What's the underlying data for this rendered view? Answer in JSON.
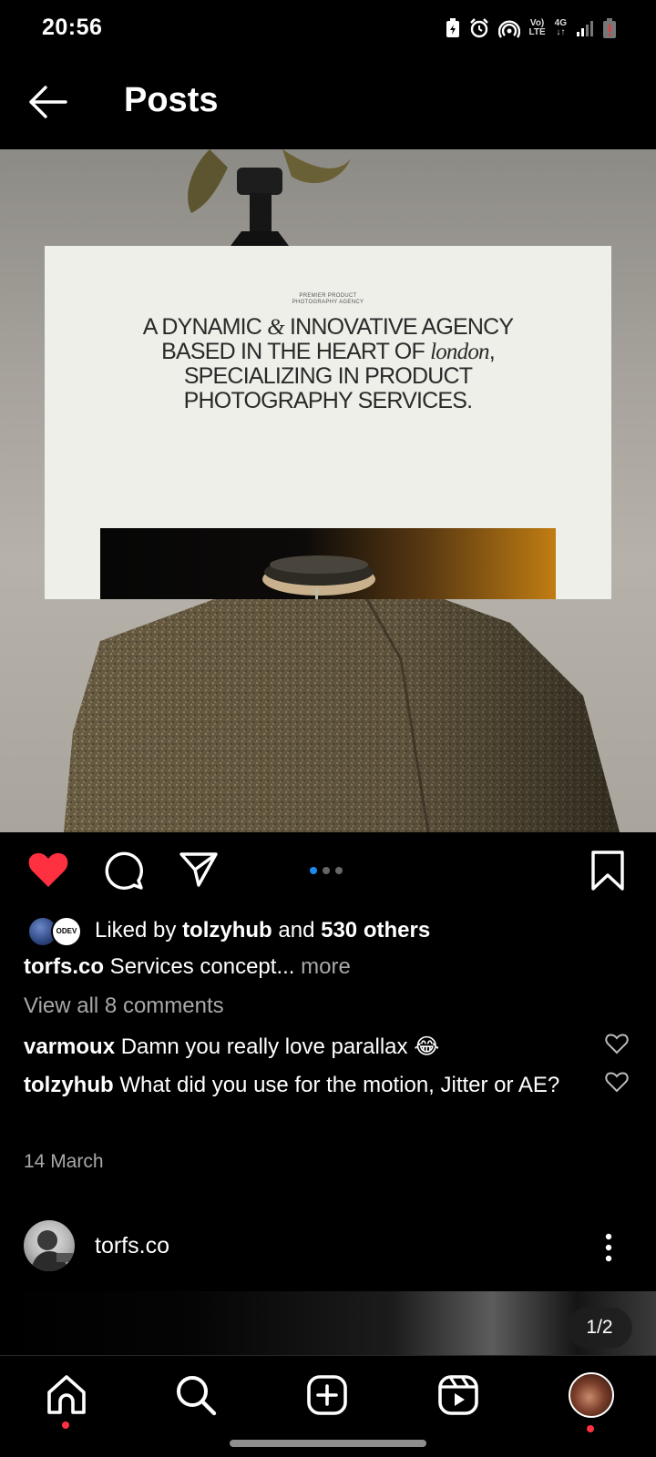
{
  "status_bar": {
    "time": "20:56",
    "volte_top": "Vo)",
    "volte_bottom": "LTE",
    "network_type": "4G",
    "icons": [
      "battery-saver-icon",
      "alarm-icon",
      "hotspot-icon",
      "volte-icon",
      "network-4g-icon",
      "signal-icon",
      "battery-low-icon"
    ]
  },
  "header": {
    "title": "Posts"
  },
  "post": {
    "card_kicker_line1": "PREMIER PRODUCT",
    "card_kicker_line2": "PHOTOGRAPHY AGENCY",
    "headline_part1": "A dynamic ",
    "headline_amp": "&",
    "headline_part2": " innovative agency based in the heart of ",
    "headline_city": "london",
    "headline_part3": ", specializing in product photography services.",
    "carousel_total": 3,
    "carousel_active": 0,
    "liked_by_prefix": "Liked by ",
    "liked_by_user": "tolzyhub",
    "liked_by_mid": " and ",
    "liked_by_count": "530 others",
    "liker_badge": "ODEV",
    "caption_user": "torfs.co",
    "caption_text": " Services concept...",
    "caption_more": " more",
    "view_comments": "View all 8 comments",
    "comments": [
      {
        "user": "varmoux",
        "text": " Damn you really love parallax 😂"
      },
      {
        "user": "tolzyhub",
        "text": " What did you use for the motion, Jitter or AE?"
      }
    ],
    "date": "14 March",
    "liked": true,
    "like_color": "#ff3040"
  },
  "next_post": {
    "username": "torfs.co",
    "counter": "1/2"
  },
  "bottom_nav": {
    "items": [
      "home-icon",
      "search-icon",
      "create-icon",
      "reels-icon",
      "profile-avatar"
    ],
    "notification_color": "#ff3040"
  }
}
